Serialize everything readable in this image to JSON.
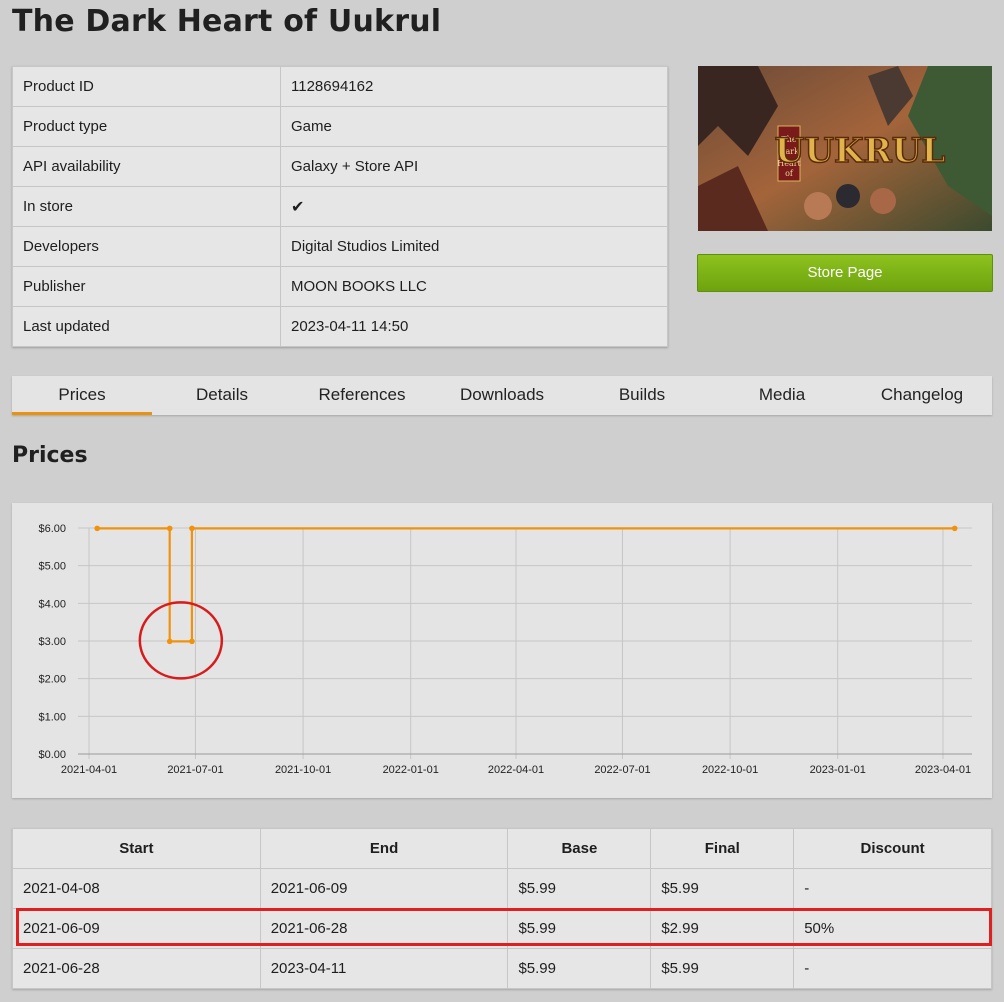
{
  "title": "The Dark Heart of Uukrul",
  "info_rows": [
    {
      "key": "Product ID",
      "value": "1128694162"
    },
    {
      "key": "Product type",
      "value": "Game"
    },
    {
      "key": "API availability",
      "value": "Galaxy + Store API"
    },
    {
      "key": "In store",
      "value": "✔"
    },
    {
      "key": "Developers",
      "value": "Digital Studios Limited"
    },
    {
      "key": "Publisher",
      "value": "MOON BOOKS LLC"
    },
    {
      "key": "Last updated",
      "value": "2023-04-11 14:50"
    }
  ],
  "cover_text": "The Dark Heart of UUKRUL",
  "store_button": "Store Page",
  "tabs": [
    "Prices",
    "Details",
    "References",
    "Downloads",
    "Builds",
    "Media",
    "Changelog"
  ],
  "active_tab": "Prices",
  "section_title": "Prices",
  "chart_data": {
    "type": "line",
    "step": true,
    "x_ticks": [
      "2021-04-01",
      "2021-07-01",
      "2021-10-01",
      "2022-01-01",
      "2022-04-01",
      "2022-07-01",
      "2022-10-01",
      "2023-01-01",
      "2023-04-01"
    ],
    "y_ticks": [
      "$0.00",
      "$1.00",
      "$2.00",
      "$3.00",
      "$4.00",
      "$5.00",
      "$6.00"
    ],
    "ylim": [
      0,
      6
    ],
    "xlim": [
      "2021-04-01",
      "2023-04-01"
    ],
    "series": [
      {
        "points": [
          {
            "x": "2021-04-08",
            "y": 5.99
          },
          {
            "x": "2021-06-09",
            "y": 5.99
          },
          {
            "x": "2021-06-09",
            "y": 2.99
          },
          {
            "x": "2021-06-28",
            "y": 2.99
          },
          {
            "x": "2021-06-28",
            "y": 5.99
          },
          {
            "x": "2023-04-11",
            "y": 5.99
          }
        ]
      }
    ],
    "grid": true,
    "line_color": "#f0920c",
    "annotation_color": "#d81b1b"
  },
  "price_table": {
    "headers": [
      "Start",
      "End",
      "Base",
      "Final",
      "Discount"
    ],
    "rows": [
      [
        "2021-04-08",
        "2021-06-09",
        "$5.99",
        "$5.99",
        "-"
      ],
      [
        "2021-06-09",
        "2021-06-28",
        "$5.99",
        "$2.99",
        "50%"
      ],
      [
        "2021-06-28",
        "2023-04-11",
        "$5.99",
        "$5.99",
        "-"
      ]
    ]
  }
}
